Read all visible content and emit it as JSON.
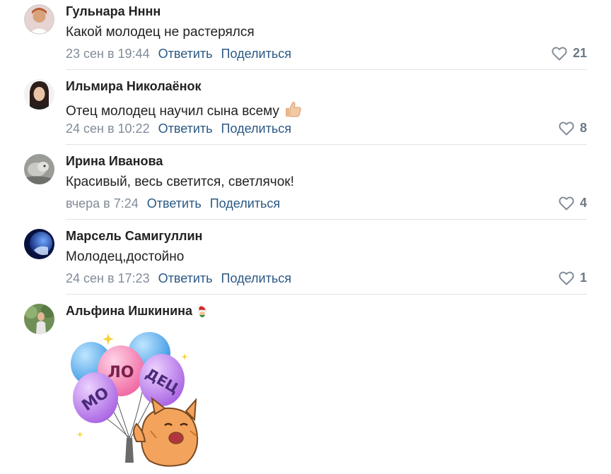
{
  "comments": [
    {
      "author": "Гульнара Нннн",
      "text": "Какой молодец не растерялся",
      "date": "23 сен в 19:44",
      "reply": "Ответить",
      "share": "Поделиться",
      "likes": "21"
    },
    {
      "author": "Ильмира Николаёнок",
      "text": "Отец молодец научил сына всему",
      "date": "24 сен в 10:22",
      "reply": "Ответить",
      "share": "Поделиться",
      "likes": "8"
    },
    {
      "author": "Ирина Иванова",
      "text": "Красивый, весь светится, светлячок!",
      "date": "вчера в 7:24",
      "reply": "Ответить",
      "share": "Поделиться",
      "likes": "4"
    },
    {
      "author": "Марсель Самигуллин",
      "text": "Молодец,достойно",
      "date": "24 сен в 17:23",
      "reply": "Ответить",
      "share": "Поделиться",
      "likes": "1"
    },
    {
      "author": "Альфина Ишкинина",
      "sticker": {
        "words": [
          "МО",
          "ЛО",
          "ДЕЦ"
        ]
      }
    }
  ],
  "icons": {
    "like": "heart-outline-icon",
    "thumbs_up": "thumbs-up-emoji-icon",
    "christmas_hat": "santa-hat-emoji-icon"
  },
  "colors": {
    "link": "#2a5885",
    "meta": "#818c99",
    "likes": "#6d7885",
    "divider": "#e1e3e6"
  }
}
